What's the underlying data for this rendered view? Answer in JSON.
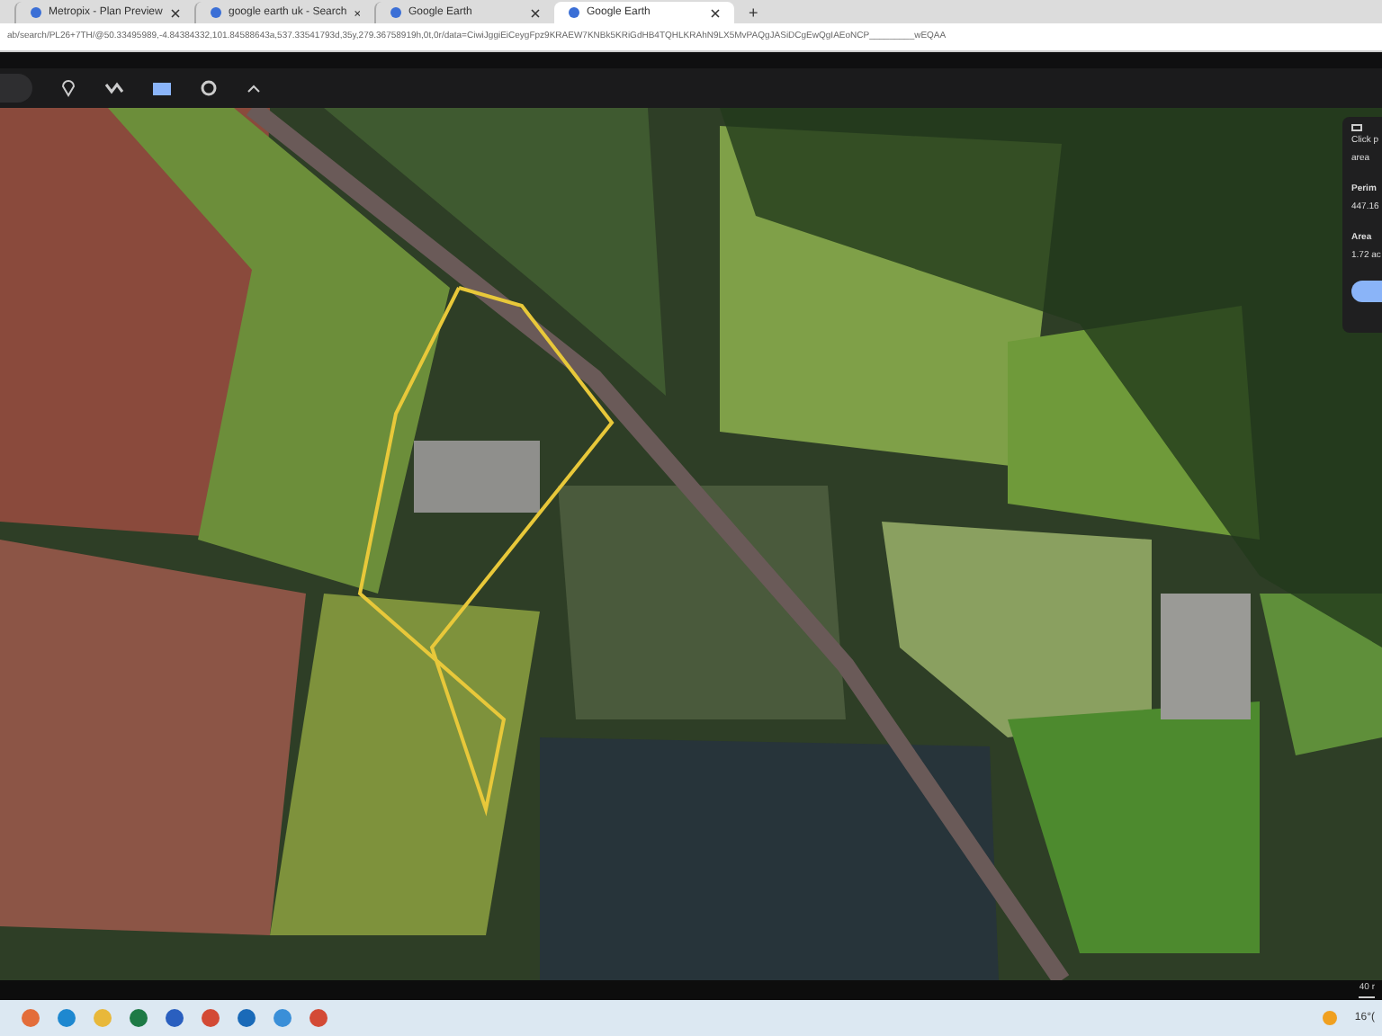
{
  "tabs": [
    {
      "title": "Metropix - Plan Preview",
      "selected": false
    },
    {
      "title": "google earth uk - Search",
      "selected": false
    },
    {
      "title": "Google Earth",
      "selected": false
    },
    {
      "title": "Google Earth",
      "selected": true
    }
  ],
  "new_tab": "+",
  "address": "ab/search/PL26+7TH/@50.33495989,-4.84384332,101.84588643a,537.33541793d,35y,279.36758919h,0t,0r/data=CiwiJggiEiCeygFpz9KRAEW7KNBk5KRiGdHB4TQHLKRAhN9LX5MvPAQgJASiDCgEwQgIAEoNCP_________wEQAA",
  "measure_panel": {
    "instruction": "Click p",
    "instruction_2": "area",
    "perimeter_label": "Perim",
    "perimeter_value": "447.16",
    "area_label": "Area",
    "area_value": "1.72 ac"
  },
  "scale": "40 r",
  "weather": "16°("
}
